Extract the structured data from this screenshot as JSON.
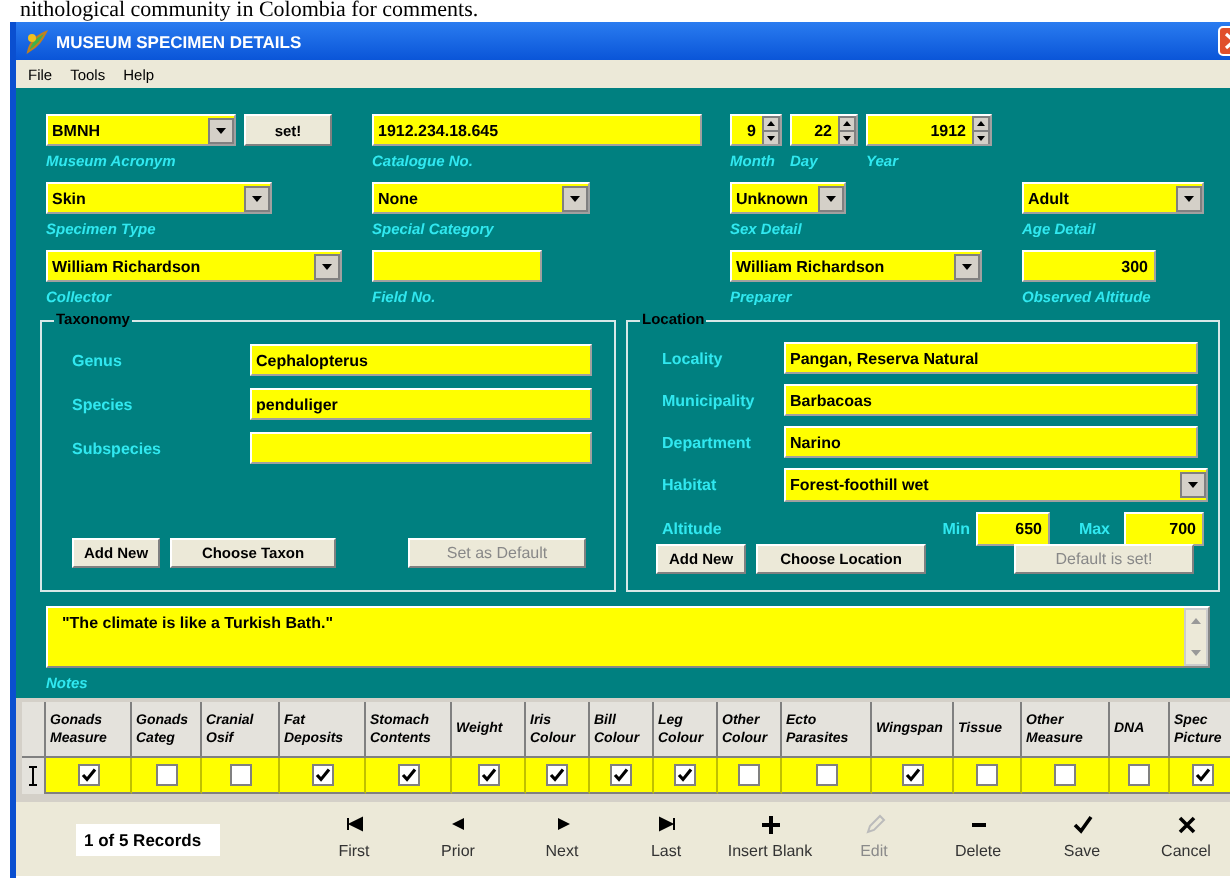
{
  "caption": "nithological community in Colombia for comments.",
  "window": {
    "title": "MUSEUM SPECIMEN DETAILS"
  },
  "menu": [
    "File",
    "Tools",
    "Help"
  ],
  "header_rows": [
    {
      "cells": [
        {
          "fields": [
            {
              "kind": "combo",
              "value": "BMNH",
              "label": "Museum Acronym"
            },
            {
              "kind": "button",
              "value": "set!"
            }
          ]
        },
        {
          "fields": [
            {
              "kind": "text",
              "value": "1912.234.18.645",
              "label": "Catalogue No."
            }
          ]
        },
        {
          "fields": [
            {
              "kind": "spin",
              "value": "9",
              "label": "Month"
            },
            {
              "kind": "spin",
              "value": "22",
              "label": "Day"
            },
            {
              "kind": "spin",
              "value": "1912",
              "label": "Year"
            }
          ]
        }
      ]
    },
    {
      "cells": [
        {
          "fields": [
            {
              "kind": "combo",
              "value": "Skin",
              "label": "Specimen Type"
            }
          ]
        },
        {
          "fields": [
            {
              "kind": "combo",
              "value": "None",
              "label": "Special Category"
            }
          ]
        },
        {
          "fields": [
            {
              "kind": "combo",
              "value": "Unknown",
              "label": "Sex Detail"
            }
          ]
        },
        {
          "fields": [
            {
              "kind": "combo",
              "value": "Adult",
              "label": "Age Detail"
            }
          ]
        }
      ]
    },
    {
      "cells": [
        {
          "fields": [
            {
              "kind": "combo",
              "value": "William Richardson",
              "label": "Collector"
            }
          ]
        },
        {
          "fields": [
            {
              "kind": "text",
              "label": "Field No."
            }
          ]
        },
        {
          "fields": [
            {
              "kind": "combo",
              "value": "William Richardson",
              "label": "Preparer"
            }
          ]
        },
        {
          "fields": [
            {
              "kind": "number",
              "value": "300",
              "label": "Observed Altitude"
            }
          ]
        }
      ]
    }
  ],
  "taxonomy": {
    "title": "Taxonomy",
    "fields": [
      {
        "kind": "text",
        "label": "Genus",
        "value": "Cephalopterus"
      },
      {
        "kind": "text",
        "label": "Species",
        "value": "penduliger"
      },
      {
        "kind": "text",
        "label": "Subspecies"
      }
    ],
    "buttons": [
      {
        "label": "Add New",
        "disabled": false
      },
      {
        "label": "Choose Taxon",
        "disabled": false
      },
      {
        "label": "Set as Default",
        "disabled": true
      }
    ]
  },
  "location": {
    "title": "Location",
    "fields": [
      {
        "kind": "text",
        "label": "Locality",
        "value": "Pangan, Reserva Natural"
      },
      {
        "kind": "text",
        "label": "Municipality",
        "value": "Barbacoas"
      },
      {
        "kind": "text",
        "label": "Department",
        "value": "Narino"
      },
      {
        "kind": "combo",
        "label": "Habitat",
        "value": "Forest-foothill wet"
      }
    ],
    "altitude": {
      "label": "Altitude",
      "min_label": "Min",
      "min": "650",
      "max_label": "Max",
      "max": "700"
    },
    "buttons": [
      {
        "label": "Add New",
        "disabled": false
      },
      {
        "label": "Choose Location",
        "disabled": false
      },
      {
        "label": "Default is set!",
        "disabled": true
      }
    ]
  },
  "notes": {
    "value": "\"The climate is like a Turkish Bath.\"",
    "label": "Notes"
  },
  "table": {
    "columns": [
      "Gonads Measure",
      "Gonads Categ",
      "Cranial Osif",
      "Fat Deposits",
      "Stomach Contents",
      "Weight",
      "Iris Colour",
      "Bill Colour",
      "Leg Colour",
      "Other Colour",
      "Ecto Parasites",
      "Wingspan",
      "Tissue",
      "Other Measure",
      "DNA",
      "Spec Picture"
    ],
    "rows": [
      {
        "checks": [
          true,
          false,
          false,
          true,
          true,
          true,
          true,
          true,
          true,
          false,
          false,
          true,
          false,
          false,
          false,
          true
        ]
      }
    ]
  },
  "nav": {
    "record_label": "1 of 5 Records",
    "buttons": [
      {
        "kind": "first",
        "label": "First",
        "disabled": false
      },
      {
        "kind": "prior",
        "label": "Prior",
        "disabled": false
      },
      {
        "kind": "next",
        "label": "Next",
        "disabled": false
      },
      {
        "kind": "last",
        "label": "Last",
        "disabled": false
      },
      {
        "kind": "insert",
        "label": "Insert Blank",
        "disabled": false
      },
      {
        "kind": "edit",
        "label": "Edit",
        "disabled": true
      },
      {
        "kind": "delete",
        "label": "Delete",
        "disabled": false
      },
      {
        "kind": "save",
        "label": "Save",
        "disabled": false
      },
      {
        "kind": "cancel",
        "label": "Cancel",
        "disabled": false
      }
    ]
  }
}
